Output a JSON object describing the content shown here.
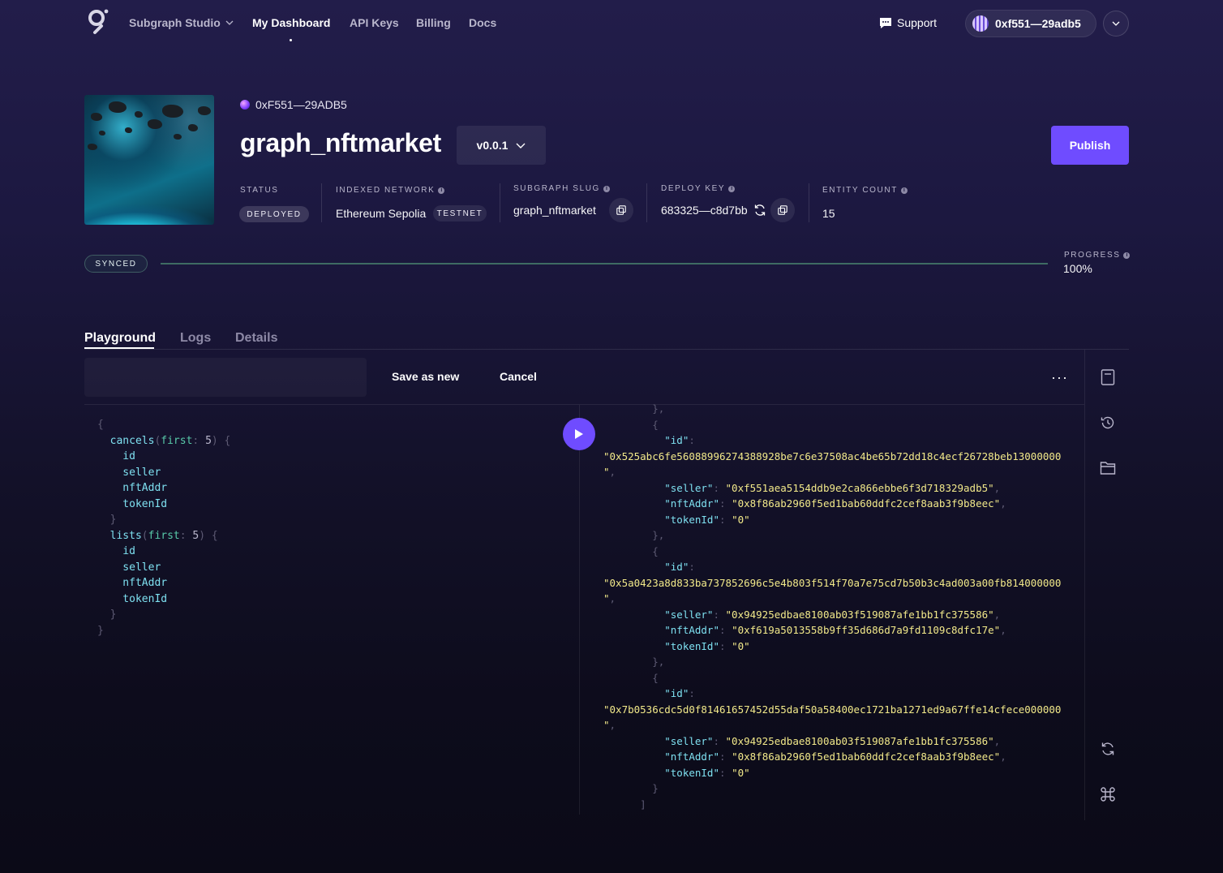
{
  "nav": {
    "studio_label": "Subgraph Studio",
    "items": [
      "My Dashboard",
      "API Keys",
      "Billing",
      "Docs"
    ],
    "support_label": "Support",
    "wallet": "0xf551—29adb5"
  },
  "subgraph": {
    "owner": "0xF551—29ADB5",
    "title": "graph_nftmarket",
    "version": "v0.0.1",
    "publish_label": "Publish"
  },
  "meta": {
    "status_label": "STATUS",
    "status_value": "DEPLOYED",
    "network_label": "INDEXED NETWORK",
    "network_value": "Ethereum Sepolia",
    "network_badge": "TESTNET",
    "slug_label": "SUBGRAPH SLUG",
    "slug_value": "graph_nftmarket",
    "deploy_label": "DEPLOY KEY",
    "deploy_value": "683325—c8d7bb",
    "entity_label": "ENTITY COUNT",
    "entity_value": "15"
  },
  "sync": {
    "status": "SYNCED",
    "progress_label": "PROGRESS",
    "progress_text": "100%",
    "progress_fraction": 1.0
  },
  "tabs": [
    "Playground",
    "Logs",
    "Details"
  ],
  "playground": {
    "query_name_placeholder": "",
    "save_as_new_label": "Save as new",
    "cancel_label": "Cancel",
    "more_label": "···"
  },
  "query": {
    "entities": [
      {
        "name": "cancels",
        "arg": "first",
        "value": "5",
        "fields": [
          "id",
          "seller",
          "nftAddr",
          "tokenId"
        ]
      },
      {
        "name": "lists",
        "arg": "first",
        "value": "5",
        "fields": [
          "id",
          "seller",
          "nftAddr",
          "tokenId"
        ]
      }
    ]
  },
  "result": {
    "records": [
      {
        "id": "\"0x525abc6fe56088996274388928be7c6e37508ac4be65b72dd18c4ecf26728beb13000000",
        "seller": "\"0xf551aea5154ddb9e2ca866ebbe6f3d718329adb5\"",
        "nftAddr": "\"0x8f86ab2960f5ed1bab60ddfc2cef8aab3f9b8eec\"",
        "tokenId": "\"0\""
      },
      {
        "id": "\"0x5a0423a8d833ba737852696c5e4b803f514f70a7e75cd7b50b3c4ad003a00fb814000000",
        "seller": "\"0x94925edbae8100ab03f519087afe1bb1fc375586\"",
        "nftAddr": "\"0xf619a5013558b9ff35d686d7a9fd1109c8dfc17e\"",
        "tokenId": "\"0\""
      },
      {
        "id": "\"0x7b0536cdc5d0f81461657452d55daf50a58400ec1721ba1271ed9a67ffe14cfece000000",
        "seller": "\"0x94925edbae8100ab03f519087afe1bb1fc375586\"",
        "nftAddr": "\"0x8f86ab2960f5ed1bab60ddfc2cef8aab3f9b8eec\"",
        "tokenId": "\"0\""
      }
    ]
  },
  "icons": {
    "logo": "graph-logo-icon",
    "support": "chat-icon",
    "copy": "copy-icon",
    "refresh": "refresh-icon",
    "play": "play-icon",
    "sidebar": [
      "document-icon",
      "history-icon",
      "folder-icon",
      "reload-icon",
      "command-icon"
    ]
  },
  "colors": {
    "accent": "#6f4cff",
    "code_field": "#7ee0f0",
    "code_string": "#f2e98a",
    "code_arg": "#58c9a9",
    "progress": "#3e6b63"
  }
}
